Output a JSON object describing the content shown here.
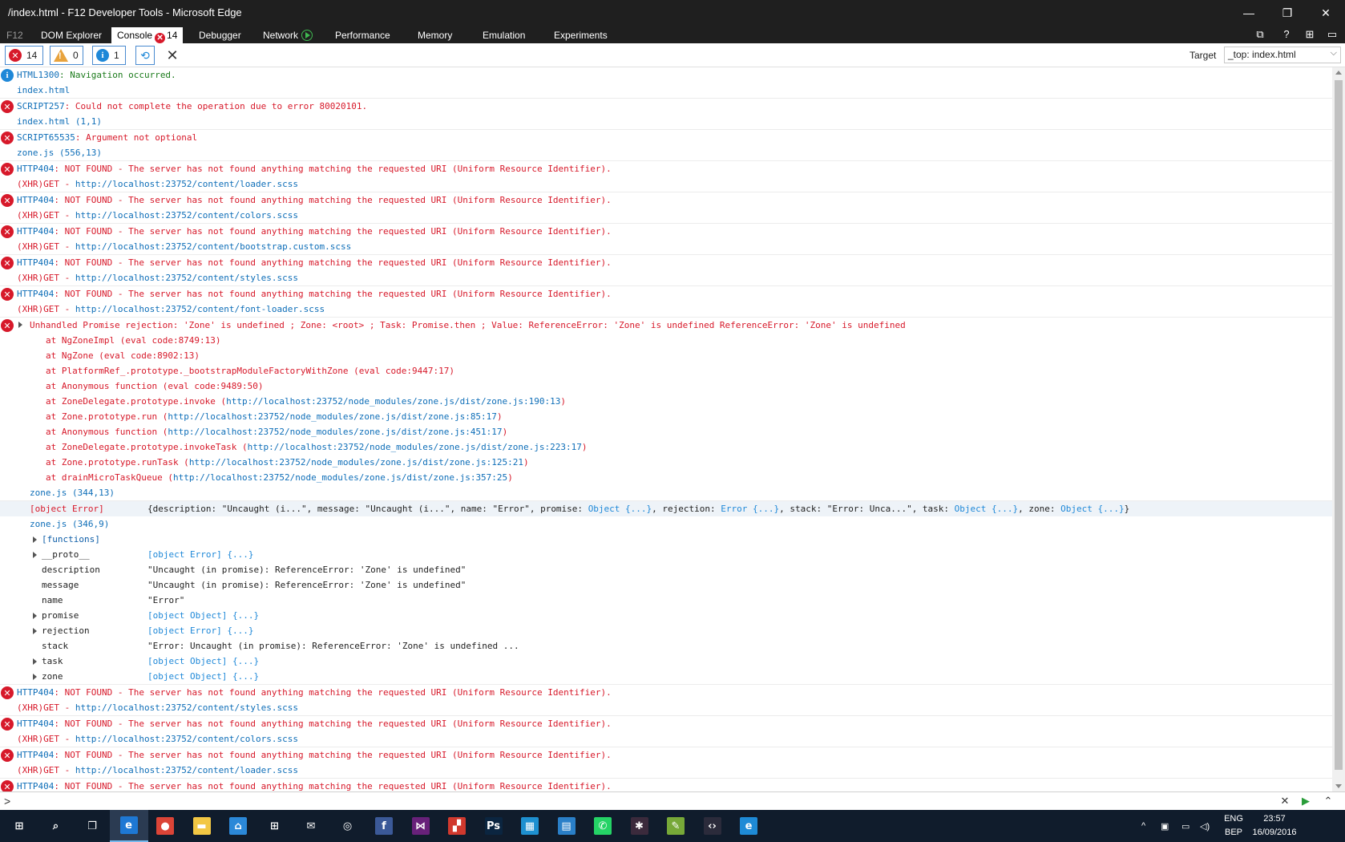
{
  "window": {
    "title": "/index.html - F12 Developer Tools - Microsoft Edge",
    "minimize": "—",
    "restore": "❐",
    "close": "✕"
  },
  "tabs": {
    "f12": "F12",
    "dom_explorer": "DOM Explorer",
    "console": "Console",
    "console_error_count": "14",
    "debugger": "Debugger",
    "network": "Network",
    "performance": "Performance",
    "memory": "Memory",
    "emulation": "Emulation",
    "experiments": "Experiments",
    "right_icons": [
      "⧉",
      "?",
      "⊞",
      "▭"
    ]
  },
  "toolbar": {
    "errors_count": "14",
    "warnings_count": "0",
    "info_count": "1",
    "target_label": "Target",
    "target_value": "_top: index.html"
  },
  "messages": [
    {
      "type": "info",
      "code": "HTML1300",
      "text": ": Navigation occurred.",
      "source": "index.html"
    },
    {
      "type": "error",
      "code": "SCRIPT257",
      "text": ": Could not complete the operation due to error 80020101.",
      "source": "index.html (1,1)"
    },
    {
      "type": "error",
      "code": "SCRIPT65535",
      "text": ": Argument not optional",
      "source": "zone.js (556,13)"
    },
    {
      "type": "error",
      "code": "HTTP404",
      "text": ": NOT FOUND - The server has not found anything matching the requested URI (Uniform Resource Identifier).",
      "xhr": "(XHR)GET - ",
      "url": "http://localhost:23752/content/loader.scss"
    },
    {
      "type": "error",
      "code": "HTTP404",
      "text": ": NOT FOUND - The server has not found anything matching the requested URI (Uniform Resource Identifier).",
      "xhr": "(XHR)GET - ",
      "url": "http://localhost:23752/content/colors.scss"
    },
    {
      "type": "error",
      "code": "HTTP404",
      "text": ": NOT FOUND - The server has not found anything matching the requested URI (Uniform Resource Identifier).",
      "xhr": "(XHR)GET - ",
      "url": "http://localhost:23752/content/bootstrap.custom.scss"
    },
    {
      "type": "error",
      "code": "HTTP404",
      "text": ": NOT FOUND - The server has not found anything matching the requested URI (Uniform Resource Identifier).",
      "xhr": "(XHR)GET - ",
      "url": "http://localhost:23752/content/styles.scss"
    },
    {
      "type": "error",
      "code": "HTTP404",
      "text": ": NOT FOUND - The server has not found anything matching the requested URI (Uniform Resource Identifier).",
      "xhr": "(XHR)GET - ",
      "url": "http://localhost:23752/content/font-loader.scss"
    }
  ],
  "promise": {
    "text": "Unhandled Promise rejection: 'Zone' is undefined ; Zone: <root> ; Task: Promise.then ; Value: ReferenceError: 'Zone' is undefined ReferenceError: 'Zone' is undefined",
    "stack": [
      {
        "text": "at NgZoneImpl (eval code:8749:13)",
        "url": ""
      },
      {
        "text": "at NgZone (eval code:8902:13)",
        "url": ""
      },
      {
        "text": "at PlatformRef_.prototype._bootstrapModuleFactoryWithZone (eval code:9447:17)",
        "url": ""
      },
      {
        "text": "at Anonymous function (eval code:9489:50)",
        "url": ""
      },
      {
        "text": "at ZoneDelegate.prototype.invoke (",
        "url": "http://localhost:23752/node_modules/zone.js/dist/zone.js:190:13",
        "tail": ")"
      },
      {
        "text": "at Zone.prototype.run (",
        "url": "http://localhost:23752/node_modules/zone.js/dist/zone.js:85:17",
        "tail": ")"
      },
      {
        "text": "at Anonymous function (",
        "url": "http://localhost:23752/node_modules/zone.js/dist/zone.js:451:17",
        "tail": ")"
      },
      {
        "text": "at ZoneDelegate.prototype.invokeTask (",
        "url": "http://localhost:23752/node_modules/zone.js/dist/zone.js:223:17",
        "tail": ")"
      },
      {
        "text": "at Zone.prototype.runTask (",
        "url": "http://localhost:23752/node_modules/zone.js/dist/zone.js:125:21",
        "tail": ")"
      },
      {
        "text": "at drainMicroTaskQueue (",
        "url": "http://localhost:23752/node_modules/zone.js/dist/zone.js:357:25",
        "tail": ")"
      }
    ],
    "source": "zone.js (344,13)"
  },
  "object_error": {
    "head": "[object Error]",
    "summary": {
      "p1": "{description: \"Uncaught (i...\", message: \"Uncaught (i...\", name: \"Error\", promise: ",
      "t1": "Object {...}",
      "p2": ", rejection: ",
      "t2": "Error {...}",
      "p3": ", stack: \"Error: Unca...\", task: ",
      "t3": "Object {...}",
      "p4": ", zone: ",
      "t4": "Object {...}",
      "p5": "}"
    },
    "source": "zone.js (346,9)",
    "functions_label": "[functions]",
    "props": [
      {
        "name": "__proto__",
        "value": "[object Error] {...}",
        "kind": "link",
        "expandable": true
      },
      {
        "name": "description",
        "value": "\"Uncaught (in promise): ReferenceError: 'Zone' is undefined\"",
        "kind": "str",
        "expandable": false
      },
      {
        "name": "message",
        "value": "\"Uncaught (in promise): ReferenceError: 'Zone' is undefined\"",
        "kind": "str",
        "expandable": false
      },
      {
        "name": "name",
        "value": "\"Error\"",
        "kind": "str",
        "expandable": false
      },
      {
        "name": "promise",
        "value": "[object Object] {...}",
        "kind": "link",
        "expandable": true
      },
      {
        "name": "rejection",
        "value": "[object Error] {...}",
        "kind": "link",
        "expandable": true
      },
      {
        "name": "stack",
        "value": "\"Error: Uncaught (in promise): ReferenceError: 'Zone' is undefined ...",
        "kind": "str",
        "expandable": false
      },
      {
        "name": "task",
        "value": "[object Object] {...}",
        "kind": "link",
        "expandable": true
      },
      {
        "name": "zone",
        "value": "[object Object] {...}",
        "kind": "link",
        "expandable": true
      }
    ]
  },
  "messages_after": [
    {
      "type": "error",
      "code": "HTTP404",
      "text": ": NOT FOUND - The server has not found anything matching the requested URI (Uniform Resource Identifier).",
      "xhr": "(XHR)GET - ",
      "url": "http://localhost:23752/content/styles.scss"
    },
    {
      "type": "error",
      "code": "HTTP404",
      "text": ": NOT FOUND - The server has not found anything matching the requested URI (Uniform Resource Identifier).",
      "xhr": "(XHR)GET - ",
      "url": "http://localhost:23752/content/colors.scss"
    },
    {
      "type": "error",
      "code": "HTTP404",
      "text": ": NOT FOUND - The server has not found anything matching the requested URI (Uniform Resource Identifier).",
      "xhr": "(XHR)GET - ",
      "url": "http://localhost:23752/content/loader.scss"
    },
    {
      "type": "error",
      "code": "HTTP404",
      "text": ": NOT FOUND - The server has not found anything matching the requested URI (Uniform Resource Identifier).",
      "xhr": "",
      "url": ""
    }
  ],
  "input": {
    "prompt": ">",
    "clear": "✕",
    "run": "▶",
    "expand": "⌃"
  },
  "taskbar": {
    "apps": [
      {
        "name": "start",
        "glyph": "⊞",
        "color": "#101c2c"
      },
      {
        "name": "search",
        "glyph": "⌕",
        "color": "#101c2c"
      },
      {
        "name": "task-view",
        "glyph": "❐",
        "color": "#101c2c"
      },
      {
        "name": "edge",
        "glyph": "e",
        "color": "#1e78d4",
        "active": true
      },
      {
        "name": "chrome",
        "glyph": "●",
        "color": "#db4437"
      },
      {
        "name": "file-explorer",
        "glyph": "▬",
        "color": "#f2c744"
      },
      {
        "name": "home",
        "glyph": "⌂",
        "color": "#2b88d8"
      },
      {
        "name": "store",
        "glyph": "⊞",
        "color": "#101c2c"
      },
      {
        "name": "mail",
        "glyph": "✉",
        "color": "#101c2c"
      },
      {
        "name": "groove",
        "glyph": "◎",
        "color": "#101c2c"
      },
      {
        "name": "facebook",
        "glyph": "f",
        "color": "#3b5998"
      },
      {
        "name": "visual-studio",
        "glyph": "⋈",
        "color": "#68217a"
      },
      {
        "name": "app-red",
        "glyph": "▞",
        "color": "#d0392e"
      },
      {
        "name": "photoshop",
        "glyph": "Ps",
        "color": "#0b2540"
      },
      {
        "name": "azure",
        "glyph": "▦",
        "color": "#1e90d0"
      },
      {
        "name": "outlook-calendar",
        "glyph": "▤",
        "color": "#2a7fc8"
      },
      {
        "name": "whatsapp",
        "glyph": "✆",
        "color": "#25d366"
      },
      {
        "name": "slack",
        "glyph": "✱",
        "color": "#3b2a3c"
      },
      {
        "name": "notepad",
        "glyph": "✎",
        "color": "#77a838"
      },
      {
        "name": "vscode",
        "glyph": "‹›",
        "color": "#2b2b3b"
      },
      {
        "name": "internet-explorer",
        "glyph": "e",
        "color": "#1e8ad6"
      }
    ],
    "lang_top": "ENG",
    "lang_bottom": "BEP",
    "time": "23:57",
    "date": "16/09/2016"
  }
}
